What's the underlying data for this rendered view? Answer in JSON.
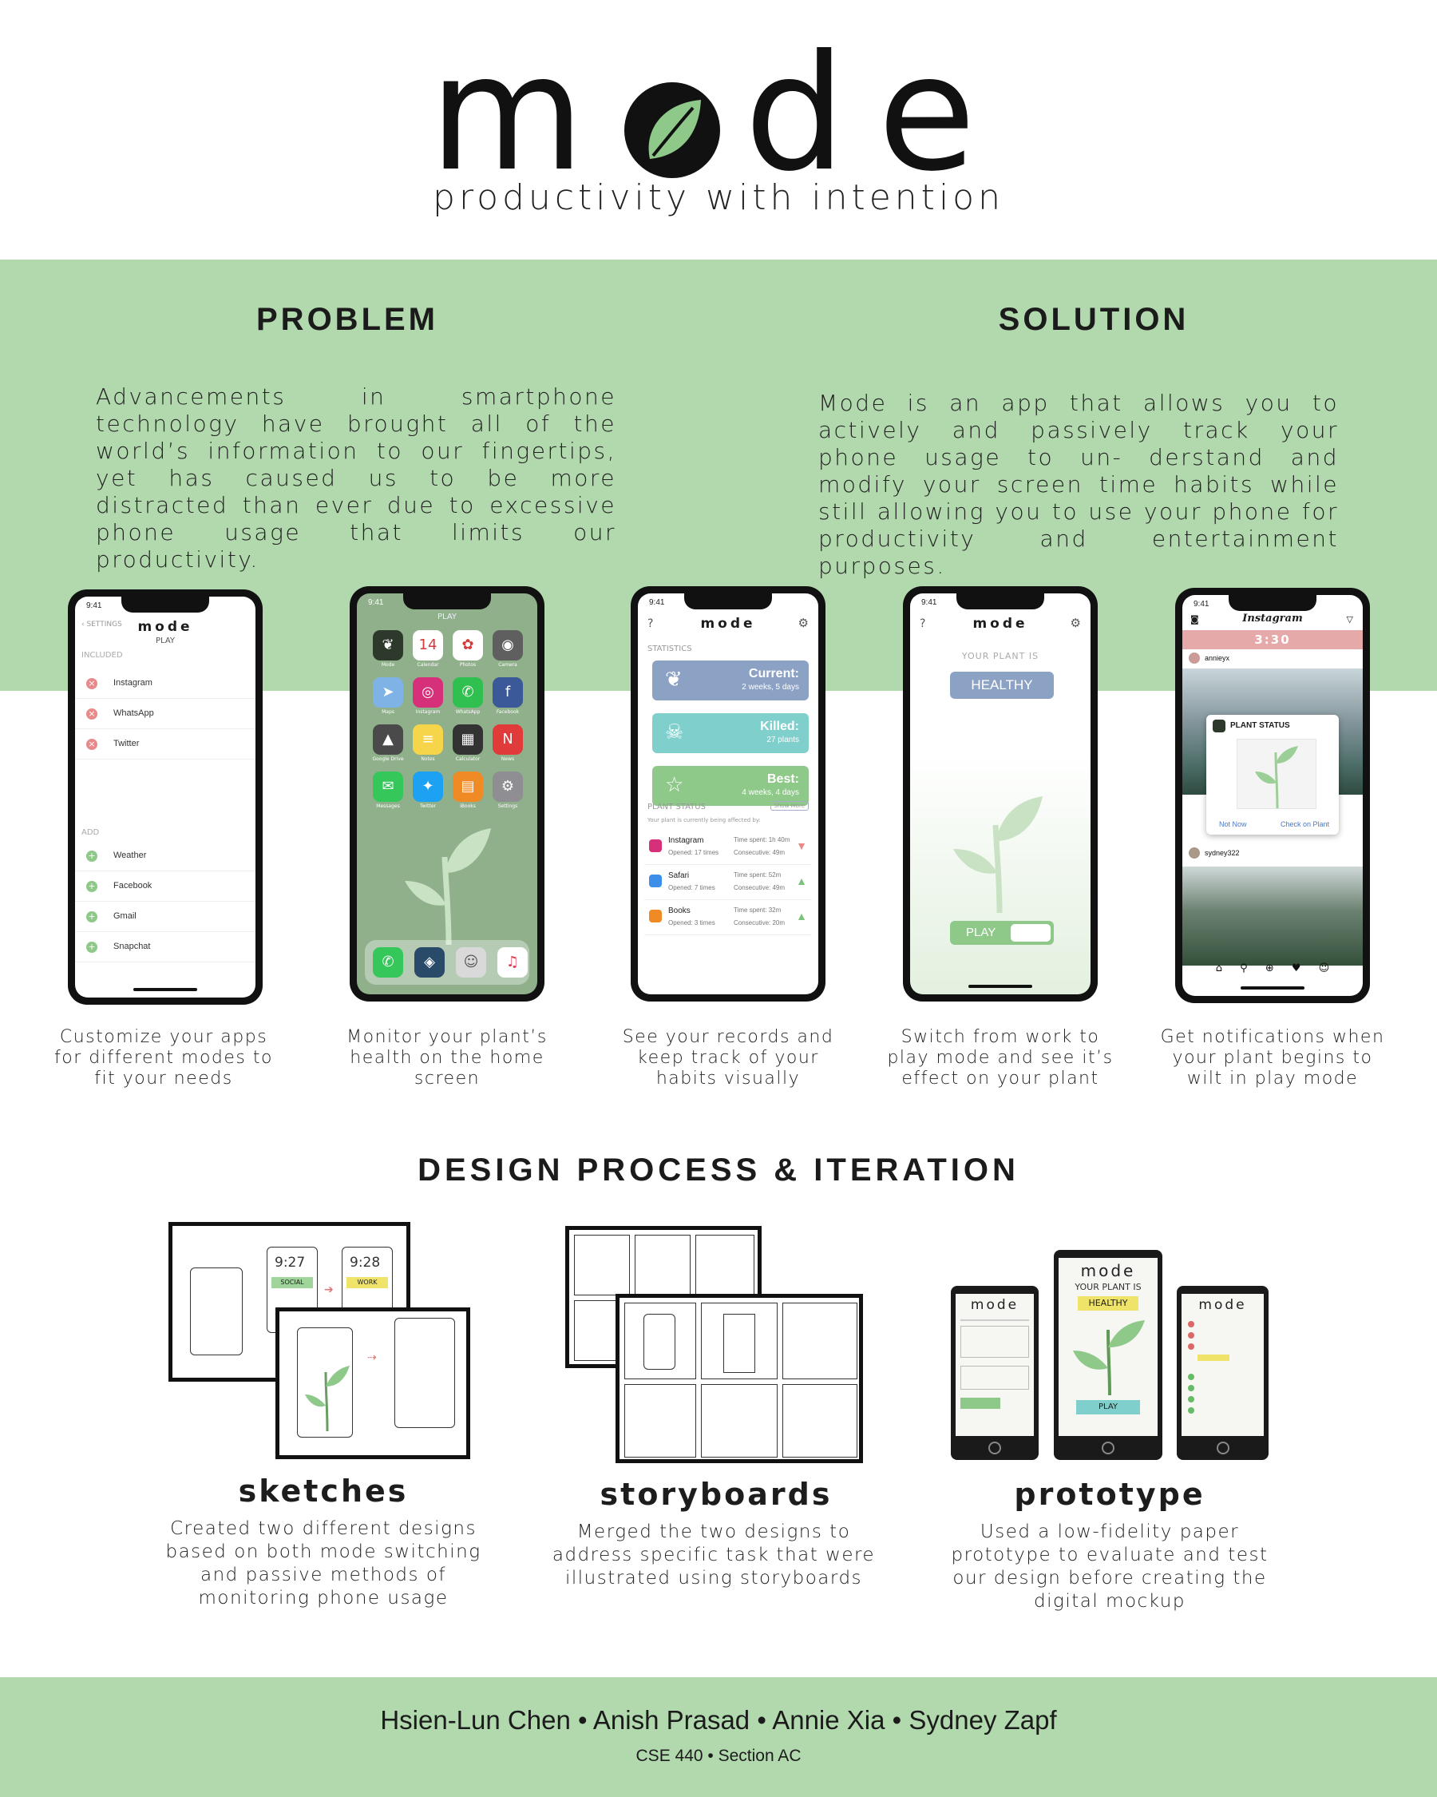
{
  "header": {
    "logo_m": "m",
    "logo_d": "d",
    "logo_e": "e",
    "tagline": "productivity with intention"
  },
  "problem": {
    "title": "PROBLEM",
    "text": "Advancements in smartphone technology have brought all of the world’s information to our fingertips, yet has caused us to be more distracted than ever due to excessive phone usage that limits our productivity."
  },
  "solution": {
    "title": "SOLUTION",
    "text": "Mode is an app that allows you to actively and passively track your phone usage to un- derstand and modify your screen time habits while still allowing you to use your phone for productivity and entertainment purposes."
  },
  "phones": {
    "time": "9:41",
    "p1": {
      "back": "SETTINGS",
      "title": "mode",
      "subtitle": "PLAY",
      "included_label": "INCLUDED",
      "included": [
        "Instagram",
        "WhatsApp",
        "Twitter"
      ],
      "add_label": "ADD",
      "add": [
        "Weather",
        "Facebook",
        "Gmail",
        "Snapchat"
      ]
    },
    "p2": {
      "play": "PLAY",
      "apps": [
        {
          "name": "Mode",
          "glyph": "❦",
          "color": "#2d3a2b"
        },
        {
          "name": "Calendar",
          "glyph": "14",
          "color": "#ffffff"
        },
        {
          "name": "Photos",
          "glyph": "✿",
          "color": "#ffffff"
        },
        {
          "name": "Camera",
          "glyph": "◉",
          "color": "#5f5f5f"
        },
        {
          "name": "Maps",
          "glyph": "➤",
          "color": "#7fb2e5"
        },
        {
          "name": "Instagram",
          "glyph": "◎",
          "color": "#d6307a"
        },
        {
          "name": "WhatsApp",
          "glyph": "✆",
          "color": "#30c04f"
        },
        {
          "name": "Facebook",
          "glyph": "f",
          "color": "#3b5998"
        },
        {
          "name": "Google Drive",
          "glyph": "▲",
          "color": "#4a4a4a"
        },
        {
          "name": "Notes",
          "glyph": "≡",
          "color": "#f6d54a"
        },
        {
          "name": "Calculator",
          "glyph": "▦",
          "color": "#333333"
        },
        {
          "name": "News",
          "glyph": "N",
          "color": "#e13a3a"
        },
        {
          "name": "Messages",
          "glyph": "✉",
          "color": "#35c759"
        },
        {
          "name": "Twitter",
          "glyph": "✦",
          "color": "#1da1f2"
        },
        {
          "name": "iBooks",
          "glyph": "▤",
          "color": "#f08a24"
        },
        {
          "name": "Settings",
          "glyph": "⚙",
          "color": "#8e8e93"
        }
      ]
    },
    "p3": {
      "title": "mode",
      "statistics_label": "STATISTICS",
      "cards": [
        {
          "title": "Current:",
          "sub": "2 weeks, 5 days",
          "color": "#8ca2c4",
          "icon": "❦"
        },
        {
          "title": "Killed:",
          "sub": "27 plants",
          "color": "#7fcfcc",
          "icon": "☠"
        },
        {
          "title": "Best:",
          "sub": "4 weeks, 4 days",
          "color": "#8ec98a",
          "icon": "☆"
        }
      ],
      "plant_status_label": "PLANT STATUS",
      "show_more": "Show More",
      "affected": "Your plant is currently being affected by:",
      "rows": [
        {
          "name": "Instagram",
          "opened": "Opened: 17 times",
          "time": "Time spent: 1h 40m",
          "consec": "Consecutive: 49m",
          "arrow": "▼",
          "arrow_color": "#e88a8a",
          "icon_color": "#d6307a"
        },
        {
          "name": "Safari",
          "opened": "Opened: 7 times",
          "time": "Time spent: 52m",
          "consec": "Consecutive: 49m",
          "arrow": "▲",
          "arrow_color": "#7cc27a",
          "icon_color": "#3c8ee8"
        },
        {
          "name": "Books",
          "opened": "Opened: 3 times",
          "time": "Time spent: 32m",
          "consec": "Consecutive: 20m",
          "arrow": "▲",
          "arrow_color": "#7cc27a",
          "icon_color": "#f08a24"
        }
      ]
    },
    "p4": {
      "title": "mode",
      "your_plant": "YOUR PLANT IS",
      "status": "HEALTHY",
      "toggle": "PLAY"
    },
    "p5": {
      "app": "Instagram",
      "timer": "3:30",
      "user1": "annieyx",
      "popup_title": "PLANT STATUS",
      "not_now": "Not Now",
      "check": "Check on Plant",
      "user2": "sydney322"
    }
  },
  "captions": [
    "Customize your apps for different modes to fit your needs",
    "Monitor your plant’s health on the home screen",
    "See your records and keep track of your habits visually",
    "Switch from work to play mode and see it’s effect on your plant",
    "Get notifications when your plant begins to wilt in play mode"
  ],
  "design_process": {
    "title": "DESIGN PROCESS & ITERATION",
    "sketches": {
      "label": "sketches",
      "text": "Created two different designs based on both mode switching and passive methods of monitoring phone usage"
    },
    "storyboards": {
      "label": "storyboards",
      "text": "Merged the two designs to address specific task that were illustrated using storyboards"
    },
    "prototype": {
      "label": "prototype",
      "text": "Used a low-fidelity paper prototype to evaluate and test our design before creating the digital mockup"
    },
    "sketch_times": [
      "9:27",
      "9:28"
    ],
    "sketch_tags": [
      "SOCIAL",
      "WORK"
    ],
    "proto_title": "mode",
    "proto_plant": "YOUR PLANT IS",
    "proto_healthy": "HEALTHY",
    "proto_play": "PLAY"
  },
  "footer": {
    "authors": "Hsien-Lun Chen • Anish Prasad • Annie Xia • Sydney Zapf",
    "course": "CSE 440 • Section AC"
  },
  "colors": {
    "green": "#b1d9ad",
    "leaf": "#8ec98a",
    "blue": "#8ca2c4",
    "teal": "#7fcfcc"
  }
}
